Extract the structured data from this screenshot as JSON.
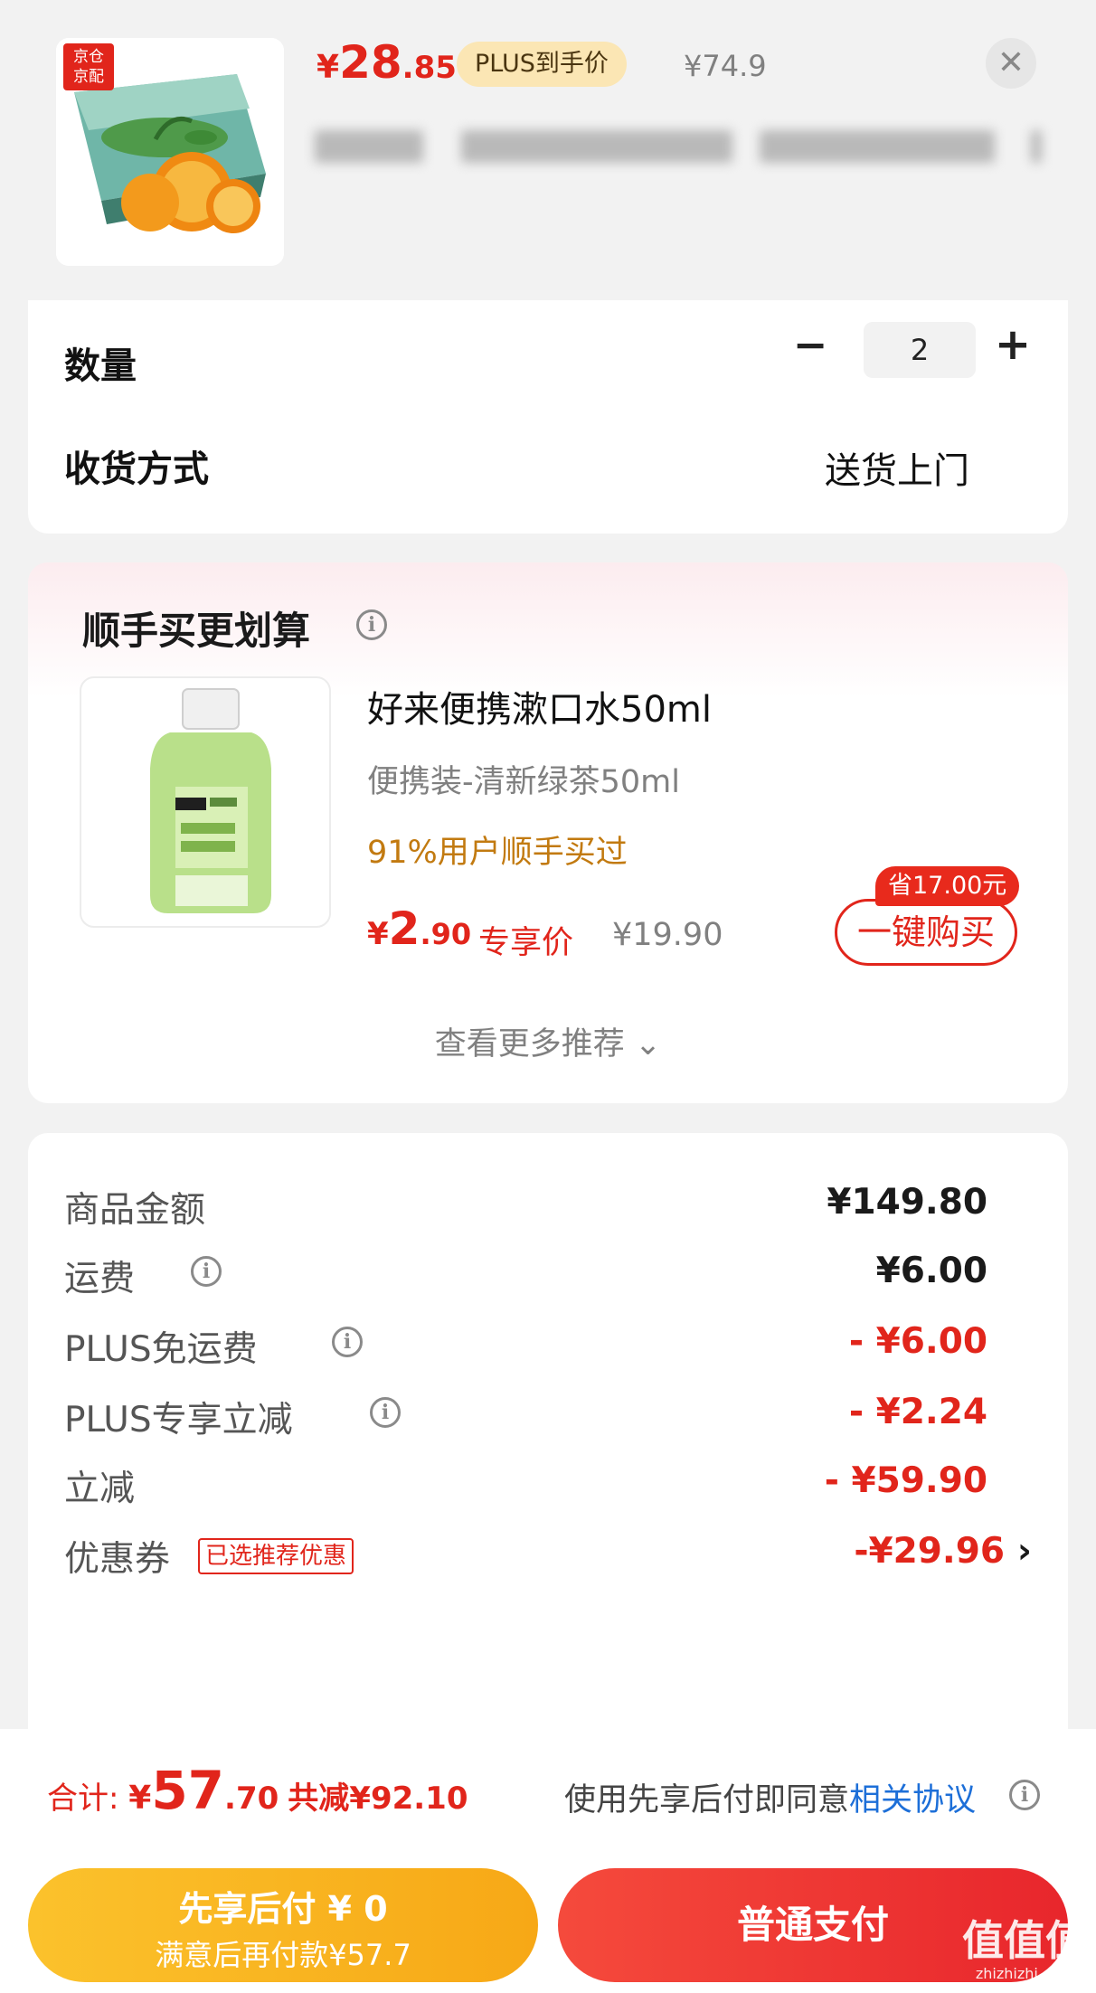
{
  "header": {
    "price_currency": "¥",
    "price_int": "28",
    "price_dec": ".85",
    "plus_badge": "PLUS到手价",
    "original_price": "¥74.9",
    "close_icon": "✕",
    "store_tag_line1": "京仓",
    "store_tag_line2": "京配"
  },
  "quantity": {
    "label": "数量",
    "minus": "−",
    "value": "2",
    "plus": "+"
  },
  "delivery": {
    "label": "收货方式",
    "value": "送货上门"
  },
  "recommend": {
    "title": "顺手买更划算",
    "product_name": "好来便携漱口水50ml",
    "spec": "便携装-清新绿茶50ml",
    "social_proof": "91%用户顺手买过",
    "price_currency": "¥",
    "price_int": "2",
    "price_dec": ".90",
    "price_tag": "专享价",
    "original_price": "¥19.90",
    "save_tag": "省17.00元",
    "buy_button": "一键购买",
    "more": "查看更多推荐 ⌄"
  },
  "summary": {
    "rows": [
      {
        "label": "商品金额",
        "value": "¥149.80",
        "red": false
      },
      {
        "label": "运费",
        "value": "¥6.00",
        "red": false
      },
      {
        "label": "PLUS免运费",
        "value": "- ¥6.00",
        "red": true
      },
      {
        "label": "PLUS专享立减",
        "value": "- ¥2.24",
        "red": true
      },
      {
        "label": "立减",
        "value": "- ¥59.90",
        "red": true
      },
      {
        "label": "优惠券",
        "value": "-¥29.96",
        "red": true
      }
    ],
    "coupon_tag": "已选推荐优惠",
    "coupon_chevron": "›"
  },
  "footer": {
    "total_label": "合计: ",
    "total_currency": "¥",
    "total_int": "57",
    "total_dec": ".70",
    "total_saved": "共减¥92.10",
    "agree_text": "使用先享后付即同意",
    "agree_link": "相关协议",
    "bnpl_line1": "先享后付 ¥ 0",
    "bnpl_line2": "满意后再付款¥57.7",
    "pay_button": "普通支付"
  },
  "watermark": {
    "text": "值值值",
    "sub": "zhizhizhi.com"
  },
  "colors": {
    "accent_red": "#e1251b",
    "plus_gold": "#fbe6b4",
    "bnpl_yellow": "#f7a816",
    "link_blue": "#1d6fd8"
  }
}
